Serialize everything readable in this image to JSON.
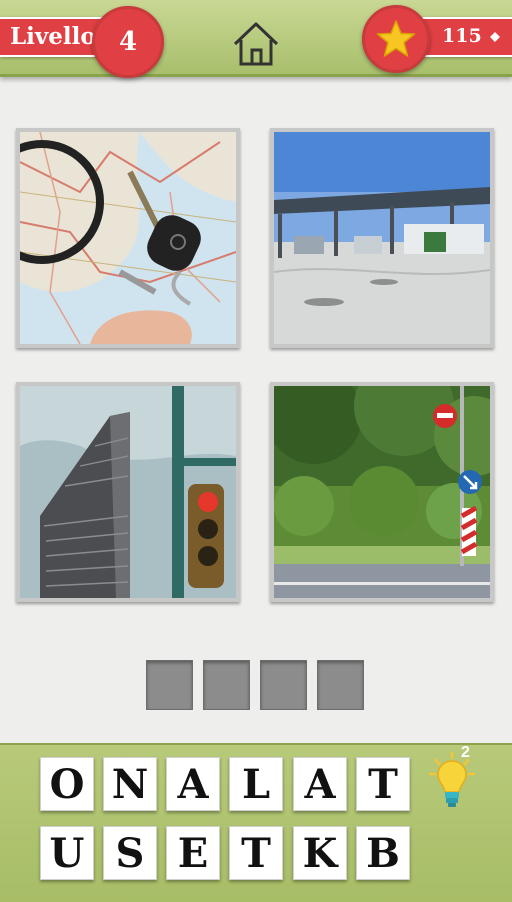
{
  "header": {
    "level_label": "Livello",
    "level_number": "4",
    "coins": "115",
    "home_icon": "home-icon",
    "star_icon": "star-icon",
    "diamond_icon": "diamond-icon"
  },
  "photos": [
    {
      "name": "map-keys-magnifier"
    },
    {
      "name": "gas-station"
    },
    {
      "name": "flatiron-building-traffic-light"
    },
    {
      "name": "road-signs-greenery"
    }
  ],
  "answer": {
    "slots": 4
  },
  "letters": {
    "row1": [
      "O",
      "N",
      "A",
      "L",
      "A",
      "T"
    ],
    "row2": [
      "U",
      "S",
      "E",
      "T",
      "K",
      "B"
    ]
  },
  "hint": {
    "count": "2",
    "icon": "lightbulb-icon"
  },
  "colors": {
    "accent_red": "#e04043",
    "bar_green": "#b2c674",
    "star_yellow": "#f7c622"
  }
}
